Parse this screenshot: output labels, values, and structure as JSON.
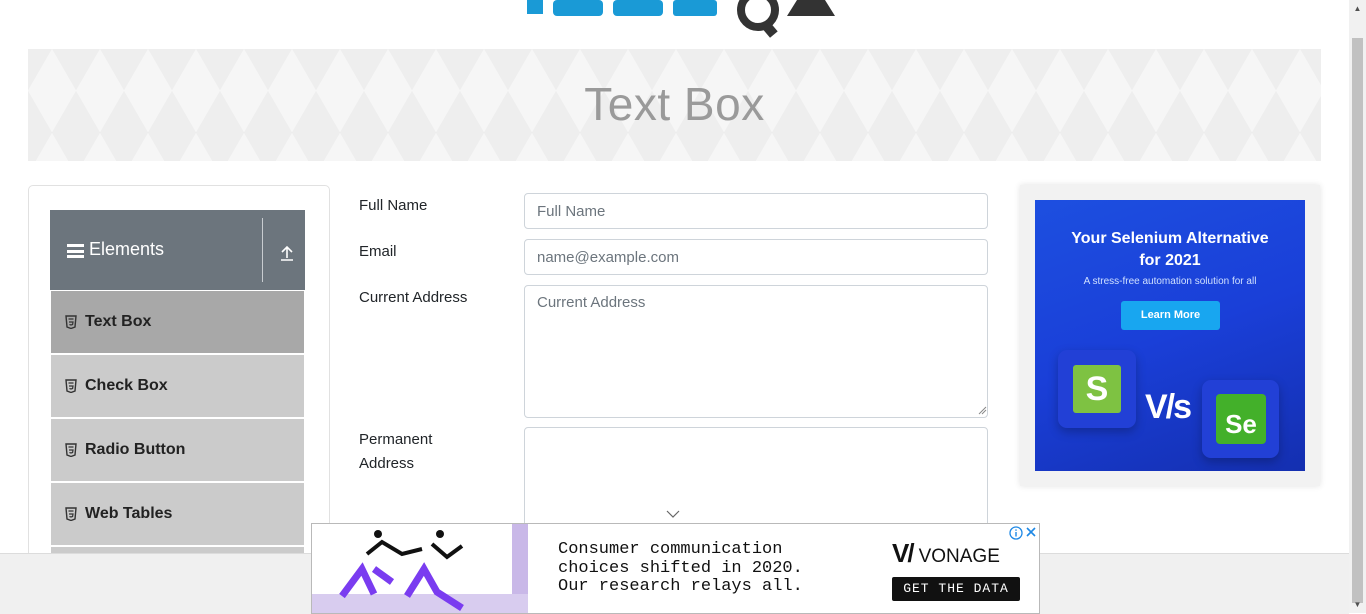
{
  "page": {
    "title": "Text Box"
  },
  "sidebar": {
    "group_title": "Elements",
    "items": [
      {
        "label": "Text Box",
        "active": true
      },
      {
        "label": "Check Box",
        "active": false
      },
      {
        "label": "Radio Button",
        "active": false
      },
      {
        "label": "Web Tables",
        "active": false
      }
    ]
  },
  "form": {
    "full_name": {
      "label": "Full Name",
      "placeholder": "Full Name",
      "value": ""
    },
    "email": {
      "label": "Email",
      "placeholder": "name@example.com",
      "value": ""
    },
    "current_address": {
      "label": "Current Address",
      "placeholder": "Current Address",
      "value": ""
    },
    "permanent_address": {
      "label_line1": "Permanent",
      "label_line2": "Address",
      "value": ""
    }
  },
  "ads": {
    "right": {
      "headline_line1": "Your Selenium Alternative",
      "headline_line2": "for 2021",
      "subtext": "A stress-free automation solution for all",
      "button": "Learn More",
      "vs": "V/s",
      "logo_s": "S",
      "logo_se": "Se"
    },
    "bottom": {
      "text": "Consumer communication\nchoices shifted in 2020.\nOur research relays all.",
      "brand": "VONAGE",
      "cta": "GET THE DATA"
    }
  },
  "colors": {
    "sidebar_header": "#6c757d",
    "menu_item": "#cbcbcb",
    "menu_item_active": "#a8a8a8",
    "ad_blue": "#1d4fe0",
    "logo_blue": "#1a9ad6",
    "logo_dark": "#333333"
  },
  "icons": [
    "menu-icon",
    "collapse-arrow-icon",
    "html5-icon",
    "gear-icon",
    "info-icon",
    "close-icon",
    "chevron-down-icon"
  ]
}
